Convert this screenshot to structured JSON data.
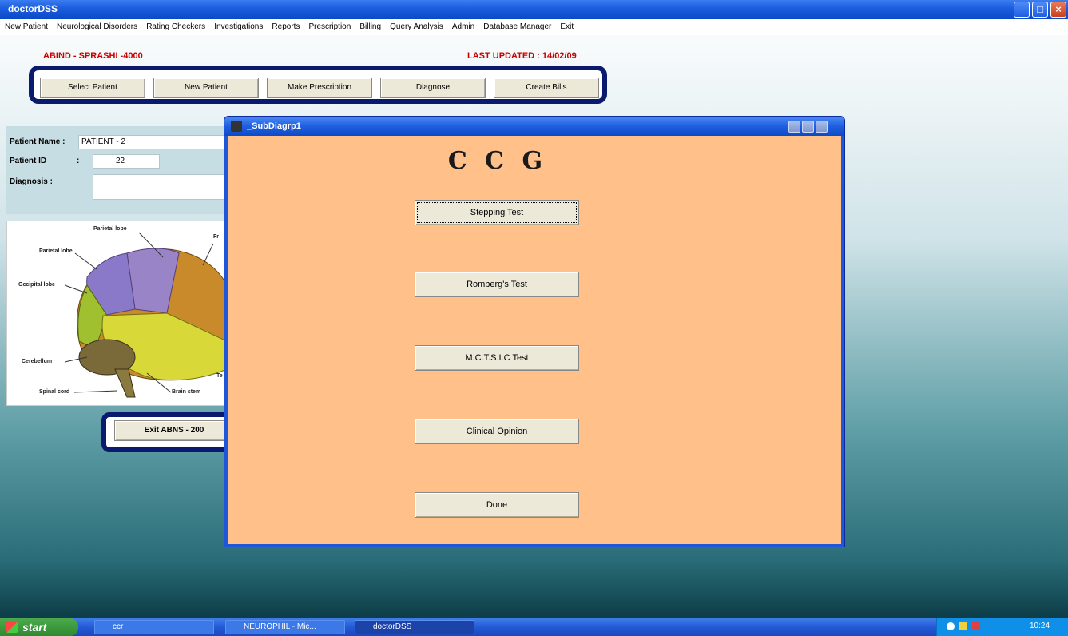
{
  "window": {
    "title": "doctorDSS"
  },
  "menu": [
    "New Patient",
    "Neurological Disorders",
    "Rating Checkers",
    "Investigations",
    "Reports",
    "Prescription",
    "Billing",
    "Query Analysis",
    "Admin",
    "Database Manager",
    "Exit"
  ],
  "header": {
    "left_label": "ABIND - SPRASHI -4000",
    "right_label": "LAST UPDATED : 14/02/09"
  },
  "toolbar": {
    "buttons": [
      "Select Patient",
      "New Patient",
      "Make Prescription",
      "Diagnose",
      "Create Bills"
    ]
  },
  "patient": {
    "name_label": "Patient Name :",
    "name_value": "PATIENT - 2",
    "id_label": "Patient ID",
    "id_colon": ":",
    "id_value": "22",
    "diagnosis_label": "Diagnosis :",
    "diagnosis_value": ""
  },
  "brain": {
    "labels": {
      "parietal": "Parietal lobe",
      "frontal_edge": "Fr",
      "occipital": "Occipital lobe",
      "temporal_edge": "Te",
      "cerebellum": "Cerebellum",
      "spinal": "Spinal cord",
      "brain_stem": "Brain stem"
    }
  },
  "exit_button": {
    "label": "Exit ABNS - 200"
  },
  "dialog": {
    "title": "_SubDiagrp1",
    "heading": "C C G",
    "buttons": [
      "Stepping Test",
      "Romberg's Test",
      "M.C.T.S.I.C Test",
      "Clinical Opinion",
      "Done"
    ]
  },
  "taskbar": {
    "start_label": "start",
    "items": [
      "ccr",
      "NEUROPHIL - Mic...",
      "doctorDSS"
    ],
    "clock": "10:24"
  },
  "colors": {
    "dialog_bg": "#ffc08a",
    "toolbar_border": "#0a1a6e",
    "header_red": "#cc0000"
  }
}
